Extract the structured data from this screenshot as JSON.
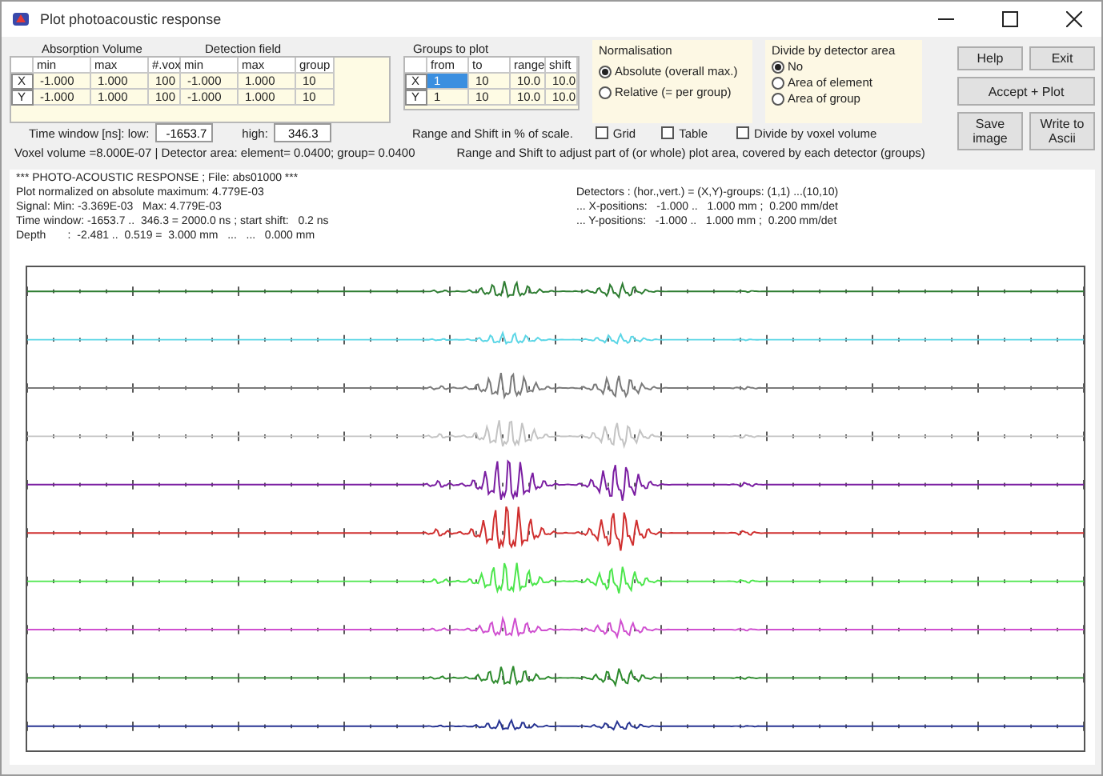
{
  "window": {
    "title": "Plot photoacoustic response"
  },
  "volume_table": {
    "group_headings": [
      "Absorption Volume",
      "Detection field"
    ],
    "columns": [
      "",
      "min",
      "max",
      "#.vox",
      "min",
      "max",
      "group"
    ],
    "rows": [
      [
        "X",
        "-1.000",
        "1.000",
        "100",
        "-1.000",
        "1.000",
        "10"
      ],
      [
        "Y",
        "-1.000",
        "1.000",
        "100",
        "-1.000",
        "1.000",
        "10"
      ]
    ]
  },
  "groups_table": {
    "heading": "Groups to plot",
    "columns": [
      "from",
      "to",
      "range",
      "shift"
    ],
    "rows": [
      {
        "label": "X",
        "cells": [
          {
            "text": "1",
            "selected": true
          },
          {
            "text": "10",
            "selected": false
          },
          {
            "text": "10.0",
            "selected": false
          },
          {
            "text": "10.0",
            "selected": false
          }
        ]
      },
      {
        "label": "Y",
        "cells": [
          {
            "text": "1",
            "selected": false
          },
          {
            "text": "10",
            "selected": false
          },
          {
            "text": "10.0",
            "selected": false
          },
          {
            "text": "10.0",
            "selected": false
          }
        ]
      }
    ]
  },
  "normalisation": {
    "title": "Normalisation",
    "options": [
      {
        "label": "Absolute (overall max.)",
        "selected": true
      },
      {
        "label": "Relative (= per group)",
        "selected": false
      }
    ]
  },
  "divide_by_area": {
    "title": "Divide by detector area",
    "options": [
      {
        "label": "No",
        "selected": true
      },
      {
        "label": "Area of element",
        "selected": false
      },
      {
        "label": "Area of group",
        "selected": false
      }
    ]
  },
  "buttons": {
    "help": "Help",
    "exit": "Exit",
    "accept": "Accept + Plot",
    "save": "Save image",
    "write": "Write to Ascii"
  },
  "time_window": {
    "label": "Time window [ns]: low:",
    "low": "-1653.7",
    "high_label": "high:",
    "high": "346.3"
  },
  "range_note": "Range and Shift in % of scale.",
  "checkboxes": [
    {
      "label": "Grid",
      "checked": false
    },
    {
      "label": "Table",
      "checked": false
    },
    {
      "label": "Divide by voxel volume",
      "checked": false
    }
  ],
  "voxel_info": "Voxel volume =8.000E-07  | Detector area: element=   0.0400; group=   0.0400",
  "range_shift_note": "Range and Shift to adjust part of (or whole) plot area, covered by each detector (groups)",
  "info": {
    "left": [
      "*** PHOTO-ACOUSTIC RESPONSE ; File: abs01000 ***",
      "Plot normalized on absolute maximum: 4.779E-03",
      "Signal: Min: -3.369E-03   Max: 4.779E-03",
      "Time window: -1653.7 ..  346.3 = 2000.0 ns ; start shift:   0.2 ns",
      "Depth       :  -2.481 ..  0.519 =  3.000 mm   ...   ...   0.000 mm"
    ],
    "right": [
      "Detectors : (hor.,vert.) = (X,Y)-groups: (1,1) ...(10,10)",
      "... X-positions:   -1.000 ..   1.000 mm ;  0.200 mm/det",
      "... Y-positions:   -1.000 ..   1.000 mm ;  0.200 mm/det"
    ]
  },
  "plot": {
    "traces": [
      {
        "color": "#2e7d32"
      },
      {
        "color": "#5cd6e6"
      },
      {
        "color": "#7a7a7a"
      },
      {
        "color": "#c4c4c4"
      },
      {
        "color": "#7b1fa2"
      },
      {
        "color": "#d03030"
      },
      {
        "color": "#4ce64c"
      },
      {
        "color": "#d050d0"
      },
      {
        "color": "#2e8b2e"
      },
      {
        "color": "#283593"
      }
    ]
  }
}
